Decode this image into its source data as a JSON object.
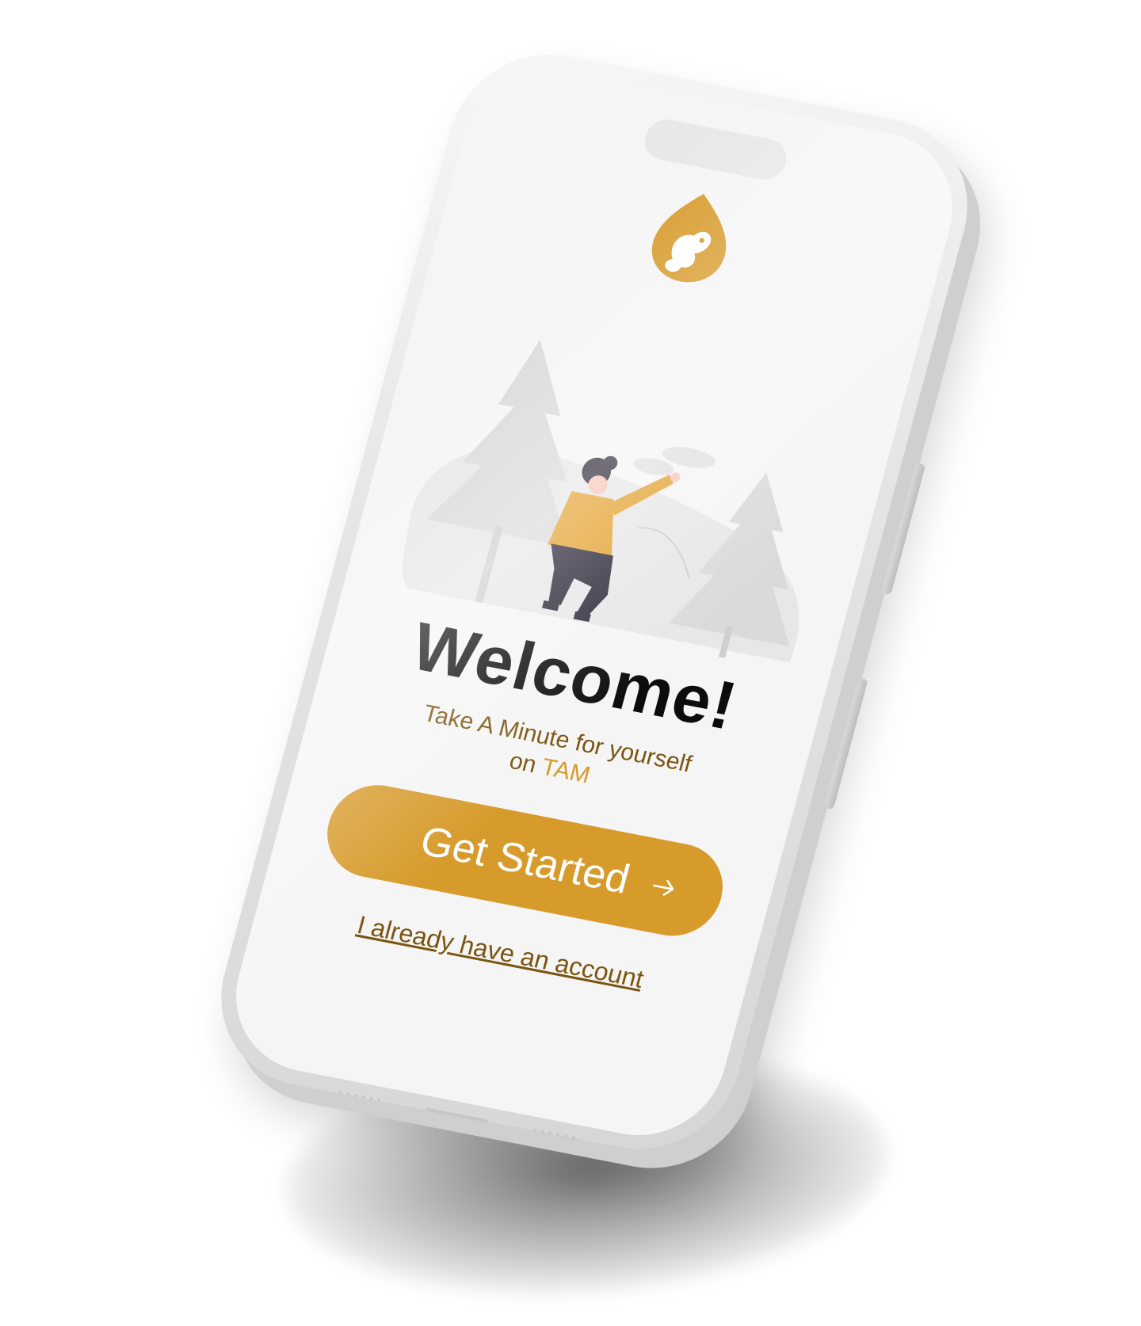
{
  "screen": {
    "title": "Welcome!",
    "tagline_line1": "Take A Minute for yourself",
    "tagline_prefix": "on ",
    "tagline_brand": "TAM",
    "cta_label": "Get Started",
    "login_label": "I already have an account"
  },
  "icons": {
    "logo": "squirrel-leaf-logo",
    "cta_arrow": "arrow-right-icon"
  },
  "colors": {
    "accent": "#d79b2c",
    "accent_text": "#7a5510",
    "title": "#0c0c0c",
    "screen_bg": "#f5f5f5"
  }
}
